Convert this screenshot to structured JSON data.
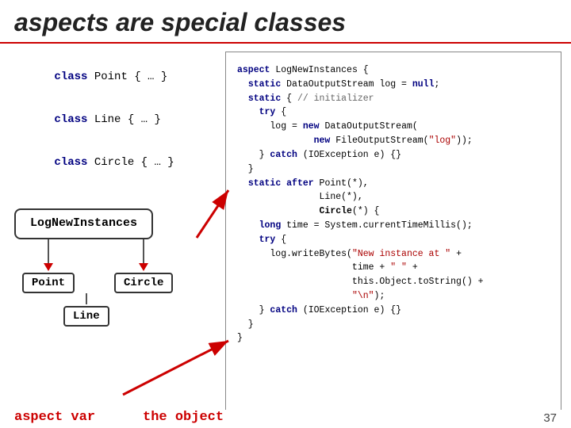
{
  "title": "aspects are special classes",
  "left_panel": {
    "lines": [
      {
        "keyword": "class",
        "rest": " Point { … }"
      },
      {
        "keyword": "class",
        "rest": " Line { … }"
      },
      {
        "keyword": "class",
        "rest": " Circle { … }"
      }
    ],
    "lni_label": "LogNewInstances",
    "nodes": [
      "Point",
      "Circle"
    ],
    "node_line": "Line"
  },
  "right_panel": {
    "code": "aspect LogNewInstances {\n  static DataOutputStream log = null;\n  static { // initializer\n    try {\n      log = new DataOutputStream(\n              new FileOutputStream(\"log\"));\n    } catch (IOException e) {}\n  }\n  static after Point(*),\n               Line(*),\n               Circle(*) {\n    long time = System.currentTimeMillis();\n    try {\n      log.writeBytes(\"New instance at \" +\n                     time + \" \" +\n                     this.Object.toString() +\n                     \"\\n\");\n    } catch (IOException e) {}\n  }\n}"
  },
  "bottom": {
    "left_label": "aspect var",
    "right_label": "the object",
    "page_number": "37"
  },
  "colors": {
    "red": "#cc0000",
    "keyword": "#000080"
  }
}
